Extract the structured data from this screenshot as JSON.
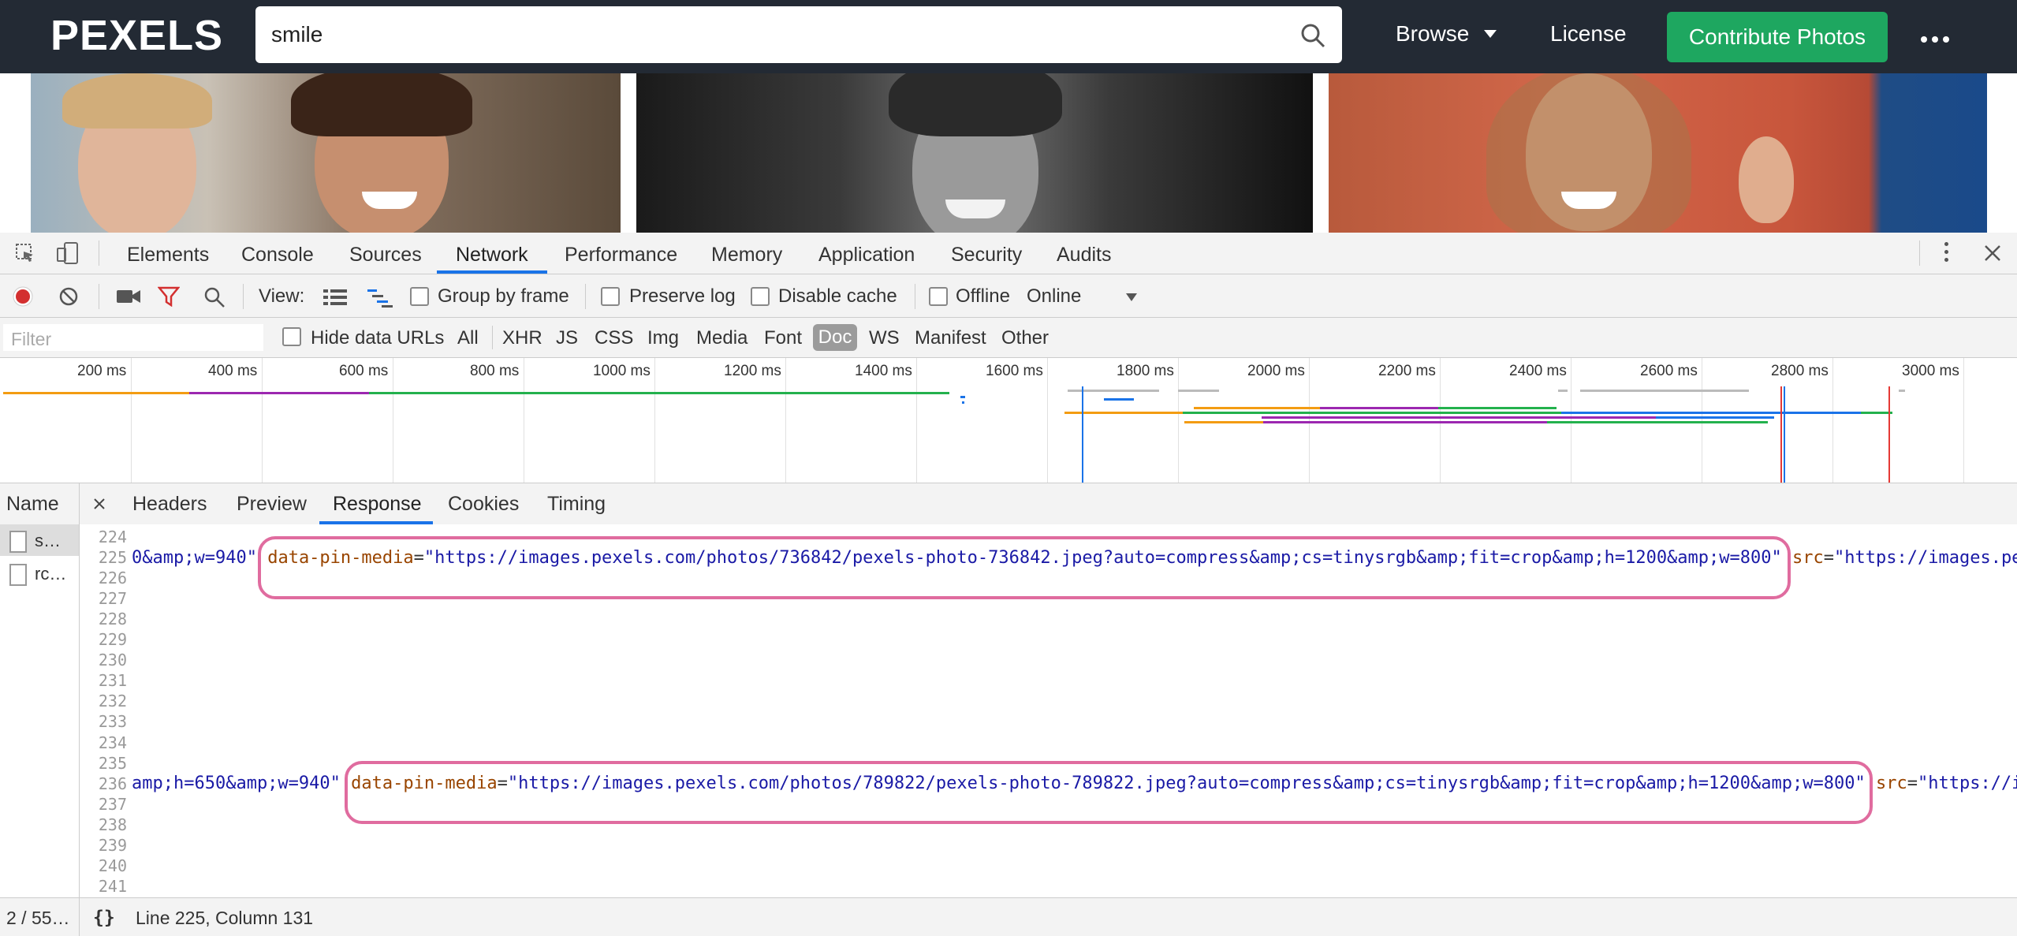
{
  "header": {
    "logo": "PEXELS",
    "search_value": "smile",
    "nav_browse": "Browse",
    "nav_license": "License",
    "contribute_label": "Contribute Photos"
  },
  "devtools": {
    "tabs": [
      "Elements",
      "Console",
      "Sources",
      "Network",
      "Performance",
      "Memory",
      "Application",
      "Security",
      "Audits"
    ],
    "active_tab": "Network",
    "toolbar": {
      "view_label": "View:",
      "group_by_frame": "Group by frame",
      "preserve_log": "Preserve log",
      "disable_cache": "Disable cache",
      "offline": "Offline",
      "throttle": "Online"
    },
    "filter": {
      "placeholder": "Filter",
      "hide_data_urls": "Hide data URLs",
      "types": [
        "All",
        "XHR",
        "JS",
        "CSS",
        "Img",
        "Media",
        "Font",
        "Doc",
        "WS",
        "Manifest",
        "Other"
      ],
      "selected_type": "Doc"
    },
    "timeline_ticks": [
      "200 ms",
      "400 ms",
      "600 ms",
      "800 ms",
      "1000 ms",
      "1200 ms",
      "1400 ms",
      "1600 ms",
      "1800 ms",
      "2000 ms",
      "2200 ms",
      "2400 ms",
      "2600 ms",
      "2800 ms",
      "3000 ms"
    ],
    "name_header": "Name",
    "requests": [
      "s…",
      "rc…"
    ],
    "panel_tabs": [
      "Headers",
      "Preview",
      "Response",
      "Cookies",
      "Timing"
    ],
    "active_panel_tab": "Response",
    "line_numbers": [
      "224",
      "225",
      "226",
      "227",
      "228",
      "229",
      "230",
      "231",
      "232",
      "233",
      "234",
      "235",
      "236",
      "237",
      "238",
      "239",
      "240",
      "241"
    ],
    "line226": {
      "prefix": "0&amp;w=940\"",
      "attr": "data-pin-media",
      "value": "\"https://images.pexels.com/photos/736842/pexels-photo-736842.jpeg?auto=compress&amp;cs=tinysrgb&amp;fit=crop&amp;h=1200&amp;w=800\"",
      "next_attr": "src",
      "next_value": "\"https://images.pe"
    },
    "line237": {
      "prefix": "amp;h=650&amp;w=940\"",
      "attr": "data-pin-media",
      "value": "\"https://images.pexels.com/photos/789822/pexels-photo-789822.jpeg?auto=compress&amp;cs=tinysrgb&amp;fit=crop&amp;h=1200&amp;w=800\"",
      "next_attr": "src",
      "next_value": "\"https://i"
    },
    "status": {
      "count": "2 / 55…",
      "pretty_print": "{}",
      "cursor": "Line 225, Column 131"
    }
  },
  "colors": {
    "header_bg": "#232a34",
    "contribute_bg": "#1ea760",
    "highlight_border": "#e06c9f",
    "attr_color": "#994500",
    "value_color": "#1a1aa6",
    "active_tab_underline": "#1a73e8",
    "record_red": "#d32f2f"
  }
}
